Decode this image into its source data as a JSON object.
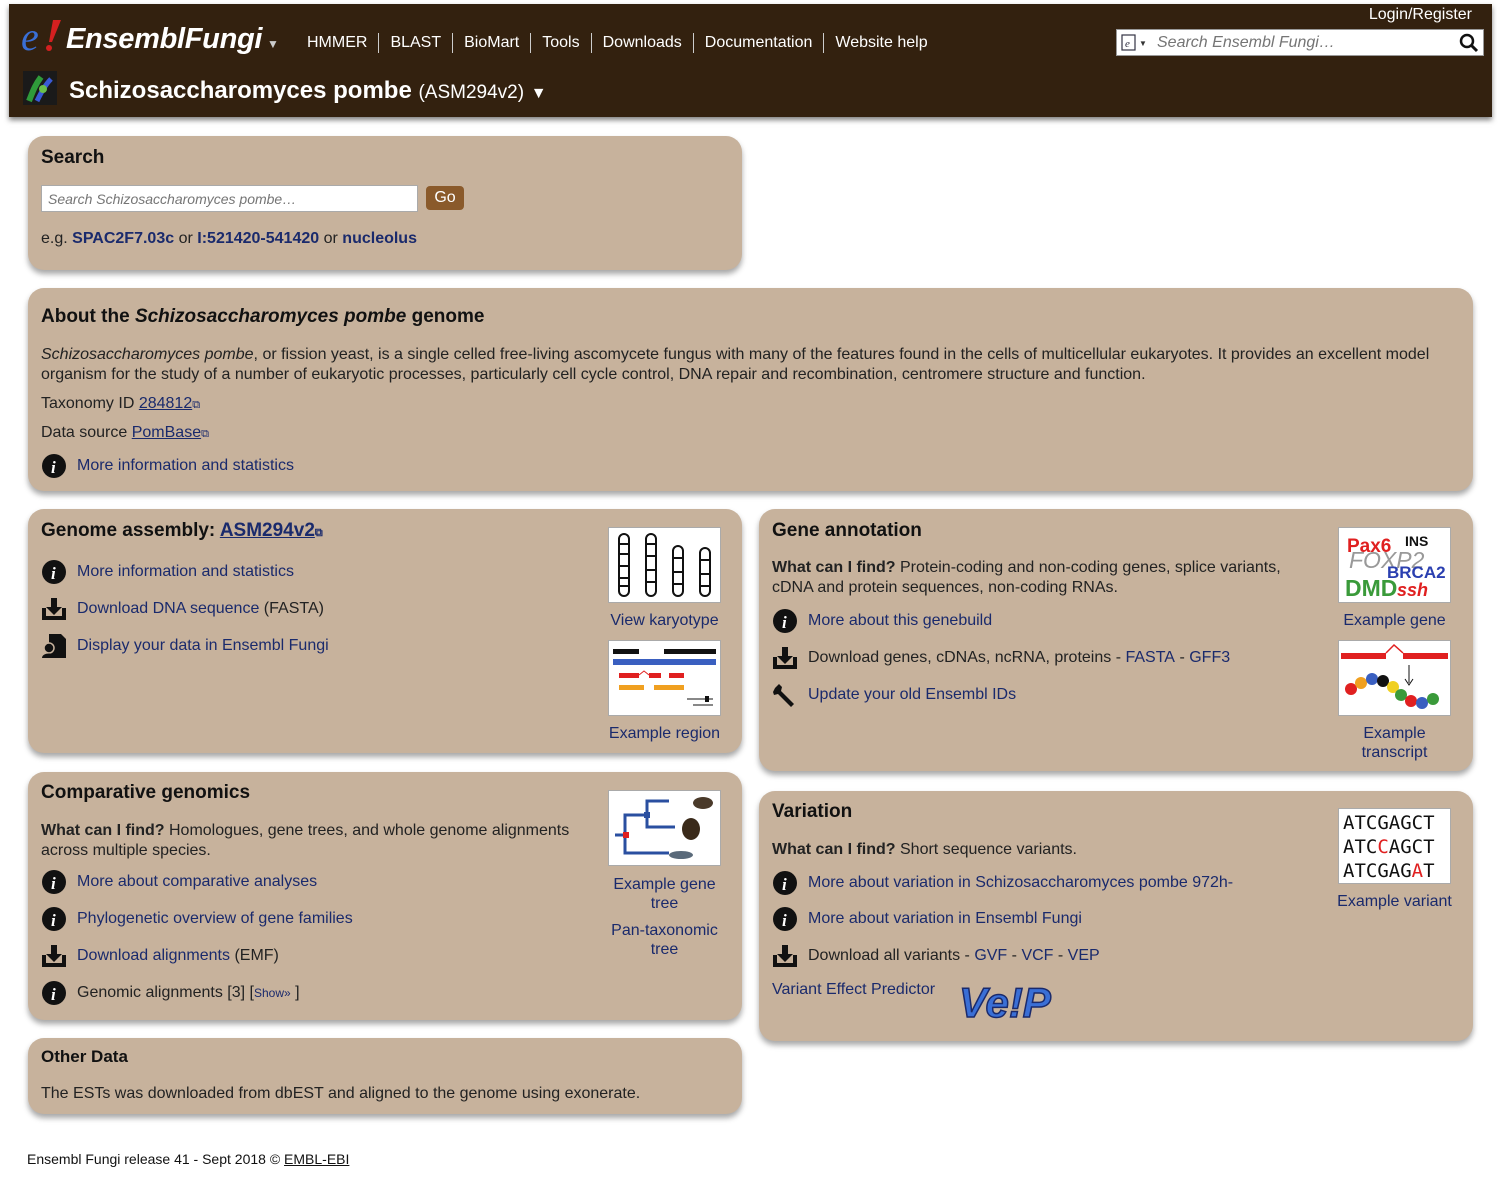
{
  "header": {
    "site_name": "EnsemblFungi",
    "nav": [
      "HMMER",
      "BLAST",
      "BioMart",
      "Tools",
      "Downloads",
      "Documentation",
      "Website help"
    ],
    "login": "Login/Register",
    "search_placeholder": "Search Ensembl Fungi…",
    "species": "Schizosaccharomyces pombe",
    "assembly": "(ASM294v2)"
  },
  "search_panel": {
    "title": "Search",
    "placeholder": "Search Schizosaccharomyces pombe…",
    "go": "Go",
    "eg": "e.g.",
    "ex1": "SPAC2F7.03c",
    "or1": "or",
    "ex2": "I:521420-541420",
    "or2": "or",
    "ex3": "nucleolus"
  },
  "about": {
    "title_pre": "About the",
    "title_species": "Schizosaccharomyces pombe",
    "title_post": "genome",
    "desc_species": "Schizosaccharomyces pombe",
    "desc": ", or fission yeast, is a single celled free-living ascomycete fungus with many of the features found in the cells of multicellular eukaryotes. It provides an excellent model organism for the study of a number of eukaryotic processes, particularly cell cycle control, DNA repair and recombination, centromere structure and function.",
    "taxonomy_label": "Taxonomy ID",
    "taxonomy_id": "284812",
    "source_label": "Data source",
    "source": "PomBase",
    "more": "More information and statistics"
  },
  "assembly": {
    "title": "Genome assembly:",
    "name": "ASM294v2",
    "more": "More information and statistics",
    "download": "Download DNA sequence",
    "download_fmt": "(FASTA)",
    "display": "Display your data in Ensembl Fungi",
    "karyotype": "View karyotype",
    "region": "Example region"
  },
  "gene": {
    "title": "Gene annotation",
    "what_label": "What can I find?",
    "what": "Protein-coding and non-coding genes, splice variants, cDNA and protein sequences, non-coding RNAs.",
    "more": "More about this genebuild",
    "download": "Download genes, cDNAs, ncRNA, proteins -",
    "fasta": "FASTA",
    "sep": "-",
    "gff3": "GFF3",
    "update": "Update your old Ensembl IDs",
    "example_gene": "Example gene",
    "example_transcript": "Example transcript",
    "gene_words": [
      "Pax6",
      "INS",
      "FOXP2",
      "BRCA2",
      "DMD",
      "ssh"
    ]
  },
  "comparative": {
    "title": "Comparative genomics",
    "what_label": "What can I find?",
    "what": "Homologues, gene trees, and whole genome alignments across multiple species.",
    "more": "More about comparative analyses",
    "phylo": "Phylogenetic overview of gene families",
    "download": "Download alignments",
    "download_fmt": "(EMF)",
    "genomic": "Genomic alignments [3]",
    "show_open": "[",
    "show": "Show»",
    "show_close": "]",
    "example_tree": "Example gene tree",
    "pan_tree": "Pan-taxonomic tree"
  },
  "variation": {
    "title": "Variation",
    "what_label": "What can I find?",
    "what": "Short sequence variants.",
    "more1": "More about variation in Schizosaccharomyces pombe 972h-",
    "more2": "More about variation in Ensembl Fungi",
    "download": "Download all variants -",
    "gvf": "GVF",
    "vcf": "VCF",
    "vep": "VEP",
    "sep": "-",
    "vep_full": "Variant Effect Predictor",
    "vep_logo": "Ve!P",
    "example": "Example variant",
    "seq_lines": [
      "ATCGAGCT",
      "ATCCAGCT",
      "ATCGAGAT"
    ]
  },
  "other": {
    "title": "Other Data",
    "text": "The ESTs was downloaded from dbEST and aligned to the genome using exonerate."
  },
  "footer": {
    "text": "Ensembl Fungi release 41 - Sept 2018 ©",
    "org": "EMBL-EBI"
  },
  "colors": {
    "masthead": "#33210f",
    "panel": "#c7b29c",
    "link": "#1a2a6c",
    "go_button": "#8a5a2b"
  }
}
